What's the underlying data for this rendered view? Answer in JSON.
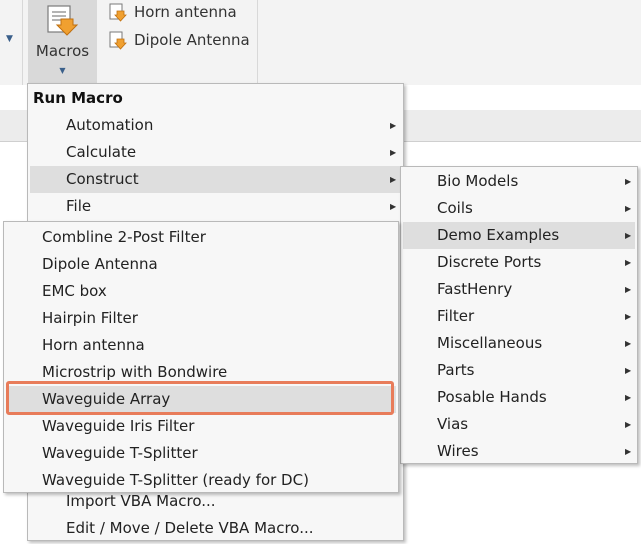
{
  "ribbon": {
    "macros_label": "Macros",
    "quick_macros": [
      "Horn antenna",
      "Dipole Antenna"
    ]
  },
  "menu_main": {
    "title": "Run Macro",
    "items": [
      {
        "label": "Automation",
        "submenu": true
      },
      {
        "label": "Calculate",
        "submenu": true
      },
      {
        "label": "Construct",
        "submenu": true,
        "highlighted": true
      },
      {
        "label": "File",
        "submenu": true
      }
    ],
    "bottom_items": [
      "Import VBA Macro...",
      "Edit / Move / Delete VBA Macro..."
    ]
  },
  "menu_construct": {
    "items": [
      {
        "label": "Bio Models",
        "submenu": true
      },
      {
        "label": "Coils",
        "submenu": true
      },
      {
        "label": "Demo Examples",
        "submenu": true,
        "highlighted": true
      },
      {
        "label": "Discrete Ports",
        "submenu": true
      },
      {
        "label": "FastHenry",
        "submenu": true
      },
      {
        "label": "Filter",
        "submenu": true
      },
      {
        "label": "Miscellaneous",
        "submenu": true
      },
      {
        "label": "Parts",
        "submenu": true
      },
      {
        "label": "Posable Hands",
        "submenu": true
      },
      {
        "label": "Vias",
        "submenu": true
      },
      {
        "label": "Wires",
        "submenu": true
      }
    ]
  },
  "menu_demo": {
    "items": [
      "Combline 2-Post Filter",
      "Dipole Antenna",
      "EMC box",
      "Hairpin Filter",
      "Horn antenna",
      "Microstrip with Bondwire",
      "Waveguide Array",
      "Waveguide Iris Filter",
      "Waveguide T-Splitter",
      "Waveguide T-Splitter (ready for DC)"
    ],
    "selected": "Waveguide Array"
  },
  "colors": {
    "highlight_row": "#dedede",
    "callout_border": "#e87c5a",
    "macro_icon": "#f0a030"
  },
  "icons": {
    "macros": "macro-script-icon",
    "quick_macro": "macro-file-icon",
    "submenu": "chevron-right-icon"
  }
}
